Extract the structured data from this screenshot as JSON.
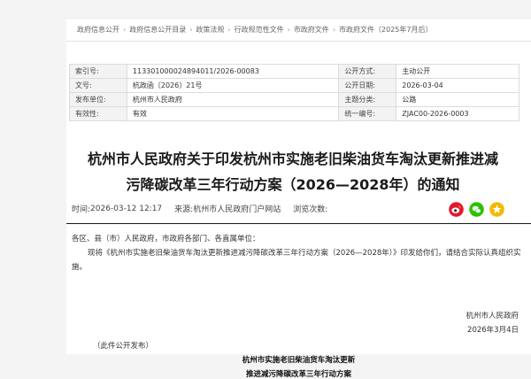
{
  "breadcrumb": [
    "政府信息公开",
    "政府信息公开目录",
    "政策法规",
    "行政规范性文件",
    "市政府文件",
    "市政府文件（2025年7月后）"
  ],
  "breadcrumb_separator": "›",
  "meta": {
    "index_label": "索引号:",
    "index_value": "113301000024894011/2026-00083",
    "disclosure_method_label": "公开方式:",
    "disclosure_method_value": "主动公开",
    "doc_no_label": "文号:",
    "doc_no_value": "杭政函〔2026〕21号",
    "date_label": "公开日期:",
    "date_value": "2026-03-04",
    "issuer_label": "发布单位:",
    "issuer_value": "杭州市人民政府",
    "subject_label": "主题分类:",
    "subject_value": "公路",
    "validity_label": "有效性:",
    "validity_value": "有效",
    "unified_no_label": "统一编号:",
    "unified_no_value": "ZJAC00-2026-0003"
  },
  "title_line1": "杭州市人民政府关于印发杭州市实施老旧柴油货车淘汰更新推进减",
  "title_line2": "污降碳改革三年行动方案（2026—2028年）的通知",
  "info": {
    "time_label": "时间:",
    "time_value": "2026-03-12 12:17",
    "source_label": "来源:",
    "source_value": "杭州市人民政府门户网站",
    "views_label": "浏览次数:"
  },
  "share_icons": [
    "weibo-icon",
    "wechat-icon",
    "qzone-icon"
  ],
  "colors": {
    "weibo": "#e6162d",
    "wechat": "#2dc100",
    "qzone": "#f5b800",
    "divider": "#1a1a1a"
  },
  "body": {
    "salutation": "各区、县（市）人民政府，市政府各部门、各直属单位：",
    "paragraph": "现将《杭州市实施老旧柴油货车淘汰更新推进减污降碳改革三年行动方案（2026—2028年）》印发给你们，请结合实际认真组织实施。"
  },
  "signature": {
    "org": "杭州市人民政府",
    "date": "2026年3月4日"
  },
  "note": "（此件公开发布）",
  "attachment_title_line1": "杭州市实施老旧柴油货车淘汰更新",
  "attachment_title_line2": "推进减污降碳改革三年行动方案"
}
